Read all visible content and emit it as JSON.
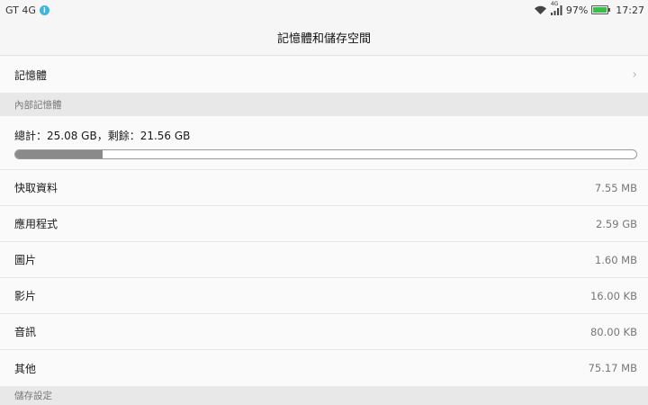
{
  "status_bar": {
    "carrier": "GT 4G",
    "network": "4G",
    "battery_percent": "97%",
    "battery_level": 0.97,
    "time": "17:27",
    "battery_color": "#3cbf4a"
  },
  "header": {
    "title": "記憶體和儲存空間"
  },
  "memory_row": {
    "label": "記憶體"
  },
  "internal_section": {
    "label": "內部記憶體"
  },
  "storage": {
    "summary": "總計：25.08 GB，剩餘：21.56 GB",
    "used_fraction": 0.14
  },
  "items": [
    {
      "label": "快取資料",
      "value": "7.55 MB"
    },
    {
      "label": "應用程式",
      "value": "2.59 GB"
    },
    {
      "label": "圖片",
      "value": "1.60 MB"
    },
    {
      "label": "影片",
      "value": "16.00 KB"
    },
    {
      "label": "音訊",
      "value": "80.00 KB"
    },
    {
      "label": "其他",
      "value": "75.17 MB"
    }
  ],
  "settings_section": {
    "label": "儲存設定"
  }
}
